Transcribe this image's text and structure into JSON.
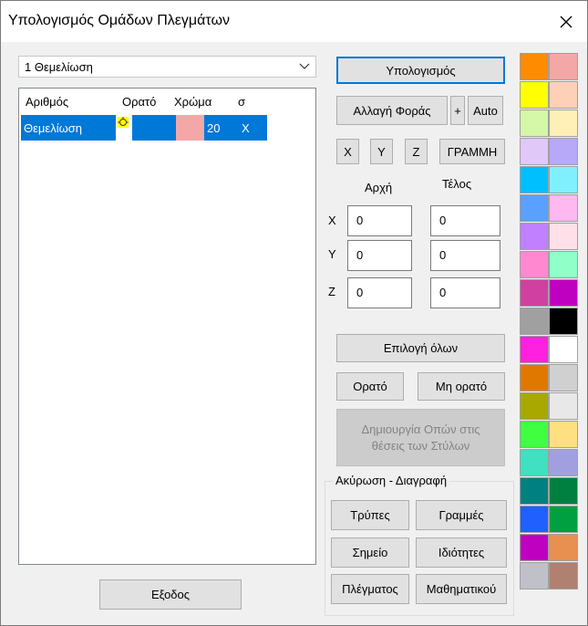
{
  "window": {
    "title": "Υπολογισμός Ομάδων Πλεγμάτων"
  },
  "combo": {
    "value": "1 Θεμελίωση"
  },
  "table": {
    "headers": [
      "Αριθμός",
      "Ορατό",
      "Χρώμα",
      "σ"
    ],
    "row": {
      "name": "Θεμελίωση",
      "color": "#f4a7a7",
      "value": "20",
      "sigma": "X"
    }
  },
  "buttons": {
    "calculate": "Υπολογισμός",
    "change_direction": "Αλλαγή Φοράς",
    "plus": "+",
    "auto": "Auto",
    "x": "X",
    "y": "Y",
    "z": "Z",
    "line": "ΓΡΑΜΜΗ",
    "select_all": "Επιλογή όλων",
    "visible": "Ορατό",
    "invisible": "Μη ορατό",
    "create_openings_1": "Δημιουργία Οπών στις",
    "create_openings_2": "θέσεις των Στύλων",
    "holes": "Τρύπες",
    "lines": "Γραμμές",
    "point": "Σημείο",
    "properties": "Ιδιότητες",
    "mesh": "Πλέγματος",
    "math": "Μαθηματικού",
    "exit": "Εξοδος"
  },
  "coords": {
    "start_label": "Αρχή",
    "end_label": "Τέλος",
    "x_label": "X",
    "y_label": "Y",
    "z_label": "Z",
    "x_start": "0",
    "x_end": "0",
    "y_start": "0",
    "y_end": "0",
    "z_start": "0",
    "z_end": "0"
  },
  "group": {
    "label": "Ακύρωση - Διαγραφή"
  },
  "palette": [
    [
      "#ff8c00",
      "#f4a7a7"
    ],
    [
      "#ffff00",
      "#ffd0b8"
    ],
    [
      "#d4f7a8",
      "#fff0b8"
    ],
    [
      "#e0c8f8",
      "#b8a8f8"
    ],
    [
      "#00bfff",
      "#80f0ff"
    ],
    [
      "#5aa0ff",
      "#ffb8f0"
    ],
    [
      "#c080ff",
      "#ffe0e8"
    ],
    [
      "#ff88d0",
      "#90ffc8"
    ],
    [
      "#d040a0",
      "#c000c0"
    ],
    [
      "#a0a0a0",
      "#000000"
    ],
    [
      "#ff20e0",
      "#ffffff"
    ],
    [
      "#e07800",
      "#d0d0d0"
    ],
    [
      "#a8a800",
      "#e8e8e8"
    ],
    [
      "#40ff40",
      "#ffe080"
    ],
    [
      "#40e0c0",
      "#a0a0e0"
    ],
    [
      "#008080",
      "#008040"
    ],
    [
      "#2060ff",
      "#00a040"
    ],
    [
      "#c000c0",
      "#e89050"
    ],
    [
      "#c0c0c8",
      "#b08070"
    ]
  ]
}
